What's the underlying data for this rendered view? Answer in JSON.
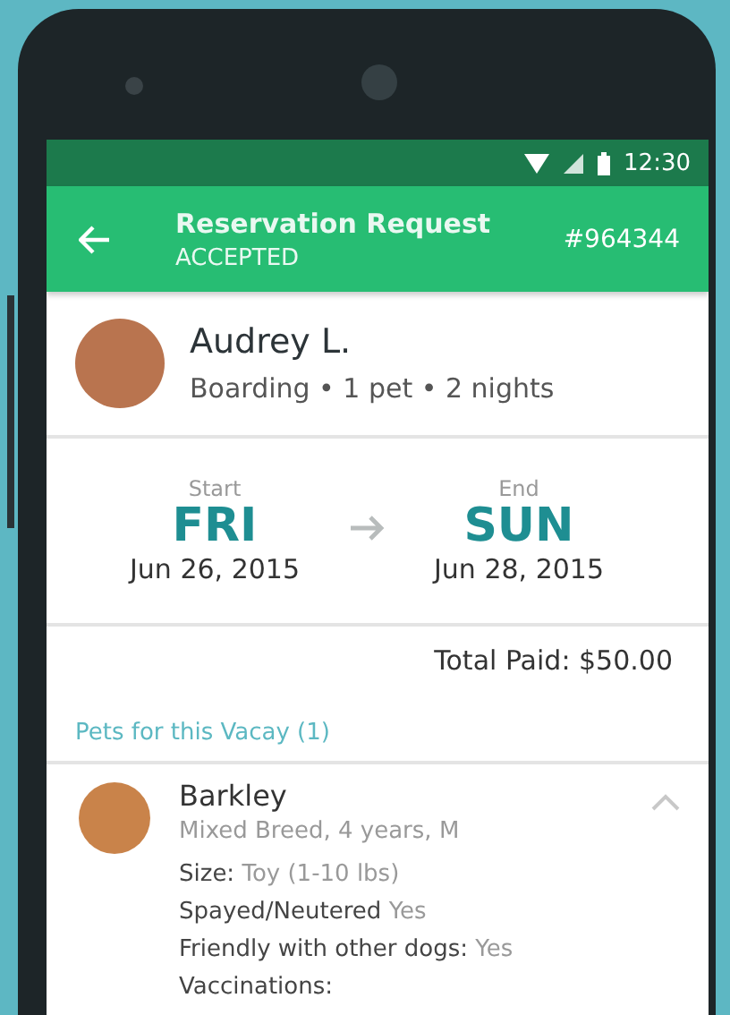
{
  "status_bar": {
    "time": "12:30"
  },
  "app_bar": {
    "title": "Reservation Request",
    "status": "ACCEPTED",
    "reservation_number": "#964344"
  },
  "owner": {
    "name": "Audrey L.",
    "summary": "Boarding • 1 pet • 2 nights"
  },
  "dates": {
    "start": {
      "label": "Start",
      "day": "FRI",
      "date": "Jun 26, 2015"
    },
    "end": {
      "label": "End",
      "day": "SUN",
      "date": "Jun 28, 2015"
    }
  },
  "total": "Total Paid: $50.00",
  "pets_header": "Pets for this Vacay (1)",
  "pets": [
    {
      "name": "Barkley",
      "description": "Mixed Breed, 4 years, M",
      "expanded": true,
      "details": [
        {
          "label": "Size:",
          "value": "Toy (1-10 lbs)"
        },
        {
          "label": "Spayed/Neutered",
          "value": "Yes"
        },
        {
          "label": "Friendly with other dogs:",
          "value": "Yes"
        },
        {
          "label": "Vaccinations:"
        }
      ]
    }
  ]
}
